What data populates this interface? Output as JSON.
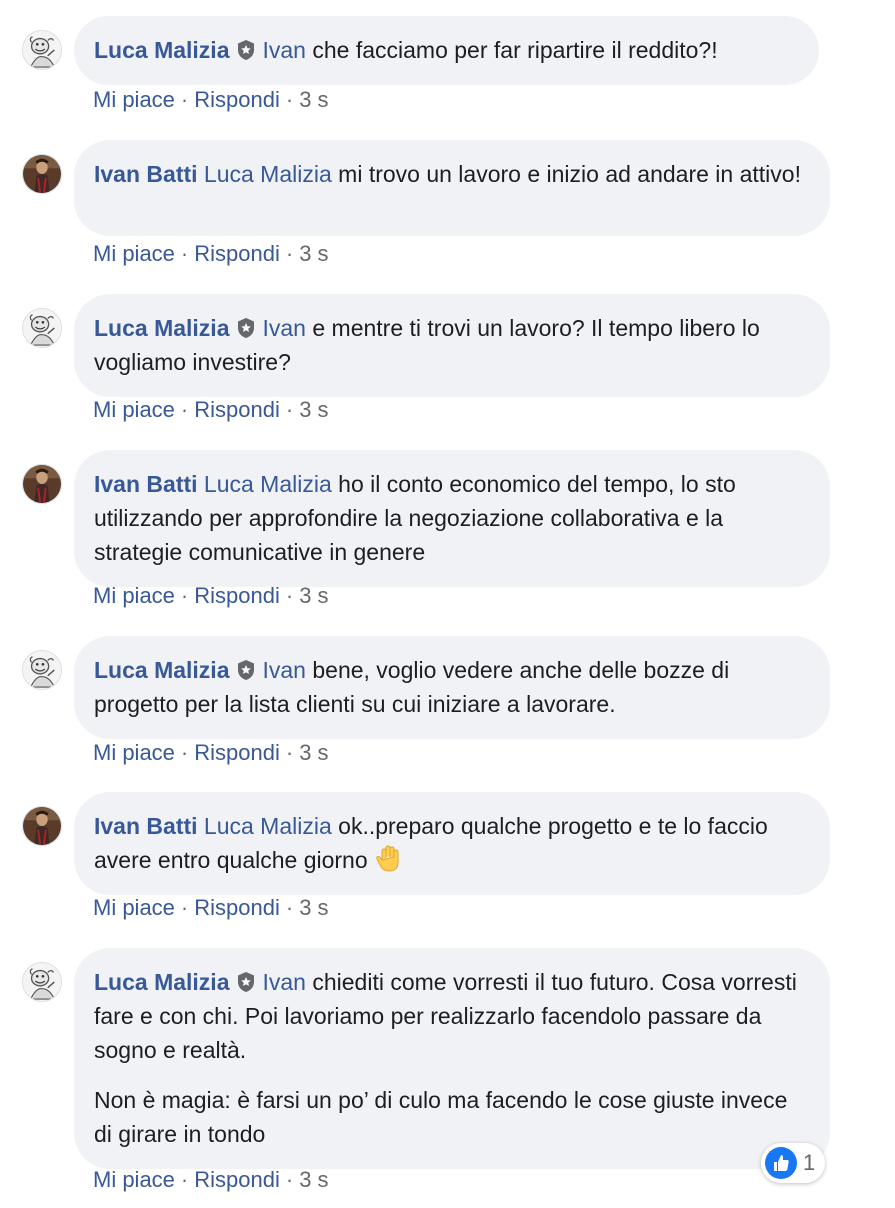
{
  "comments": [
    {
      "author": "Luca Malizia",
      "verified": true,
      "avatar": "luca",
      "mention": "Ivan",
      "text": "che facciamo per far ripartire il reddito?!",
      "like_label": "Mi piace",
      "reply_label": "Rispondi",
      "time": "3 s"
    },
    {
      "author": "Ivan Batti",
      "verified": false,
      "avatar": "ivan",
      "mention": "Luca Malizia",
      "text": "mi trovo un lavoro e inizio ad andare in attivo!",
      "like_label": "Mi piace",
      "reply_label": "Rispondi",
      "time": "3 s"
    },
    {
      "author": "Luca Malizia",
      "verified": true,
      "avatar": "luca",
      "mention": "Ivan",
      "text": "e mentre ti trovi un lavoro? Il tempo libero lo vogliamo investire?",
      "like_label": "Mi piace",
      "reply_label": "Rispondi",
      "time": "3 s"
    },
    {
      "author": "Ivan Batti",
      "verified": false,
      "avatar": "ivan",
      "mention": "Luca Malizia",
      "text": "ho il conto economico del tempo, lo sto utilizzando per approfondire la negoziazione collaborativa e la strategie comunicative in genere",
      "like_label": "Mi piace",
      "reply_label": "Rispondi",
      "time": "3 s"
    },
    {
      "author": "Luca Malizia",
      "verified": true,
      "avatar": "luca",
      "mention": "Ivan",
      "text": "bene, voglio vedere anche delle bozze di progetto per la lista clienti su cui iniziare a lavorare.",
      "like_label": "Mi piace",
      "reply_label": "Rispondi",
      "time": "3 s"
    },
    {
      "author": "Ivan Batti",
      "verified": false,
      "avatar": "ivan",
      "mention": "Luca Malizia",
      "text": "ok..preparo qualche progetto e te lo faccio avere entro qualche giorno",
      "emoji": "raised-hand-icon",
      "like_label": "Mi piace",
      "reply_label": "Rispondi",
      "time": "3 s"
    },
    {
      "author": "Luca Malizia",
      "verified": true,
      "avatar": "luca",
      "mention": "Ivan",
      "text": "chiediti come vorresti il tuo futuro. Cosa vorresti fare e con chi. Poi lavoriamo per realizzarlo facendolo passare da sogno e realtà.",
      "text2": "Non è magia: è farsi un po’ di culo ma facendo le cose giuste invece di girare in tondo",
      "like_label": "Mi piace",
      "reply_label": "Rispondi",
      "time": "3 s",
      "reactions": {
        "icon": "like-icon",
        "count": "1"
      }
    }
  ],
  "colors": {
    "link": "#385898",
    "bubble": "#f0f2f5",
    "text": "#1c1e21",
    "meta": "#65676b",
    "like_blue": "#1877f2"
  }
}
